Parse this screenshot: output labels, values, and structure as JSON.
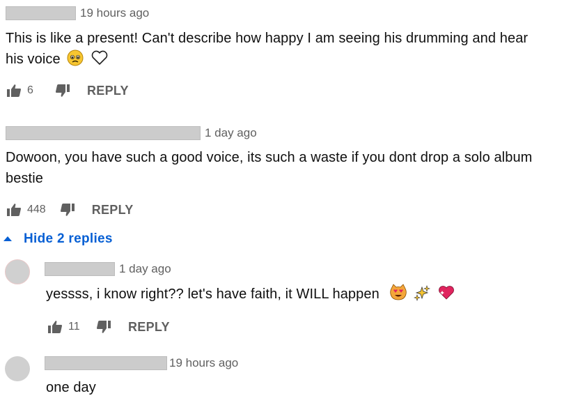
{
  "comments": [
    {
      "timestamp": "19 hours ago",
      "text_line1": "This is like a present! Can't describe how happy I am seeing his drumming and hear",
      "text_line2": "his voice",
      "emojis": [
        "pleading-face-emoji",
        "heart-outline-icon"
      ],
      "likes": "6",
      "reply_label": "REPLY"
    },
    {
      "timestamp": "1 day ago",
      "text_line1": "Dowoon, you have such a good voice, its such a waste if you dont drop a solo album",
      "text_line2": "bestie",
      "likes": "448",
      "reply_label": "REPLY",
      "replies_toggle": "Hide 2 replies",
      "replies": [
        {
          "timestamp": "1 day ago",
          "text": "yessss, i know right?? let's have faith, it WILL happen",
          "emojis": [
            "heart-eyes-cat-emoji",
            "sparkles-emoji",
            "sparkling-heart-emoji"
          ],
          "likes": "11",
          "reply_label": "REPLY"
        },
        {
          "timestamp": "19 hours ago",
          "text": "one day"
        }
      ]
    }
  ],
  "colors": {
    "link_blue": "#065fd4",
    "muted_text": "#606060",
    "redaction": "#cccccc"
  }
}
